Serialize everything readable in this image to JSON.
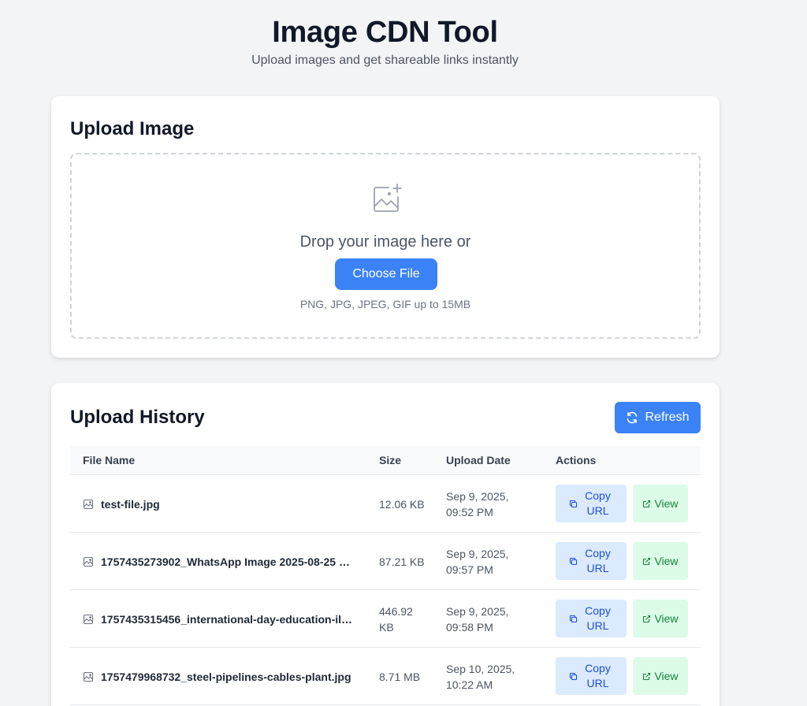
{
  "header": {
    "title": "Image CDN Tool",
    "subtitle": "Upload images and get shareable links instantly"
  },
  "upload": {
    "title": "Upload Image",
    "drop_text": "Drop your image here or",
    "choose_label": "Choose File",
    "hint": "PNG, JPG, JPEG, GIF up to 15MB"
  },
  "history": {
    "title": "Upload History",
    "refresh_label": "Refresh",
    "columns": [
      "File Name",
      "Size",
      "Upload Date",
      "Actions"
    ],
    "rows": [
      {
        "name": "test-file.jpg",
        "size": "12.06 KB",
        "date": "Sep 9, 2025, 09:52 PM",
        "copy": "Copy URL",
        "view": "View"
      },
      {
        "name": "1757435273902_WhatsApp Image 2025-08-25 at...",
        "size": "87.21 KB",
        "date": "Sep 9, 2025, 09:57 PM",
        "copy": "Copy URL",
        "view": "View"
      },
      {
        "name": "1757435315456_international-day-education-illu...",
        "size": "446.92 KB",
        "date": "Sep 9, 2025, 09:58 PM",
        "copy": "Copy URL",
        "view": "View"
      },
      {
        "name": "1757479968732_steel-pipelines-cables-plant.jpg",
        "size": "8.71 MB",
        "date": "Sep 10, 2025, 10:22 AM",
        "copy": "Copy URL",
        "view": "View"
      }
    ]
  },
  "colors": {
    "primary": "#3b82f6",
    "copy_bg": "#dbeafe",
    "copy_text": "#1d4ed8",
    "view_bg": "#dcfce7",
    "view_text": "#15803d",
    "page_bg": "#f3f4f6"
  },
  "icons": {
    "upload": "image-plus-icon",
    "refresh": "refresh-icon",
    "file": "image-file-icon",
    "copy": "copy-icon",
    "view": "external-link-icon"
  }
}
